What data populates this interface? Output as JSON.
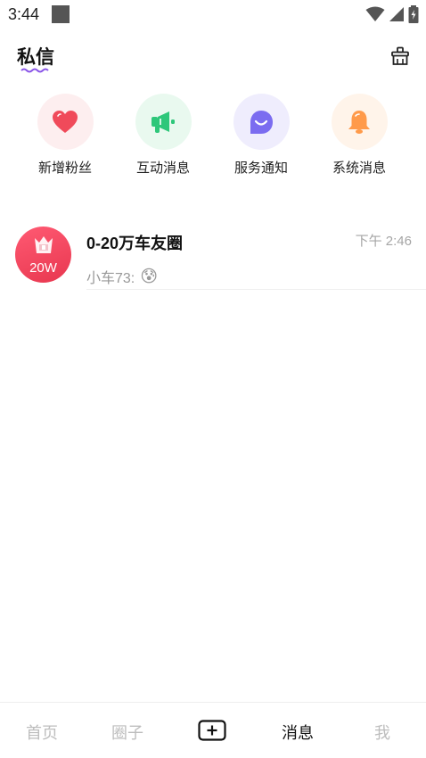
{
  "status_bar": {
    "time": "3:44"
  },
  "header": {
    "title": "私信"
  },
  "quick_entries": [
    {
      "label": "新增粉丝",
      "icon": "heart-icon",
      "color": "#f04a5a",
      "bg": "#fdeeef"
    },
    {
      "label": "互动消息",
      "icon": "megaphone-icon",
      "color": "#2ec77a",
      "bg": "#e9f9ef"
    },
    {
      "label": "服务通知",
      "icon": "chat-bubble-icon",
      "color": "#7b6cf0",
      "bg": "#efedfd"
    },
    {
      "label": "系统消息",
      "icon": "bell-icon",
      "color": "#ff9a4a",
      "bg": "#fff4ea"
    }
  ],
  "conversations": [
    {
      "name": "0-20万车友圈",
      "time": "下午 2:46",
      "preview_sender": "小车73:",
      "preview_emoji": "😰",
      "avatar_text": "20W"
    }
  ],
  "bottom_nav": {
    "home": "首页",
    "circle": "圈子",
    "messages": "消息",
    "me": "我"
  }
}
